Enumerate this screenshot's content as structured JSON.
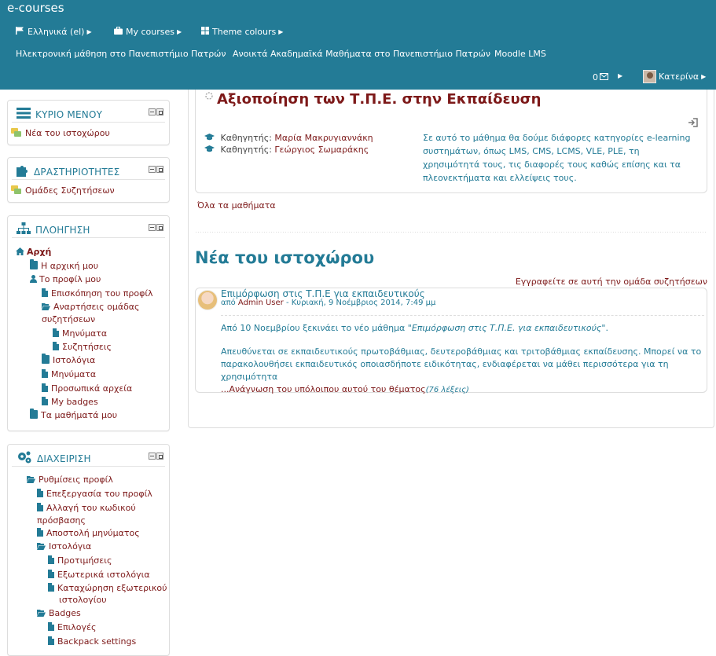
{
  "header": {
    "brand": "e-courses",
    "menu": {
      "language": "Ελληνικά (el)",
      "my_courses": "My courses",
      "theme_colours": "Theme colours"
    },
    "links": [
      "Ηλεκτρονική μάθηση στο Πανεπιστήμιο Πατρών",
      "Ανοικτά Ακαδημαϊκά Μαθήματα στο Πανεπιστήμιο Πατρών",
      "Moodle LMS"
    ],
    "messages_count": "0",
    "user_name": "Κατερίνα",
    "colors": {
      "bar": "#237b96"
    }
  },
  "blocks": {
    "main_menu": {
      "title": "ΚΥΡΙΟ ΜΕΝΟΥ",
      "items": [
        "Νέα του ιστοχώρου"
      ]
    },
    "activities": {
      "title": "ΔΡΑΣΤΗΡΙΟΤΗΤΕΣ",
      "items": [
        "Ομάδες Συζητήσεων"
      ]
    },
    "navigation": {
      "title": "ΠΛΟΗΓΗΣΗ",
      "items": [
        "Αρχή",
        "Η αρχική μου",
        "Το προφίλ μου",
        "Επισκόπηση του προφίλ",
        "Αναρτήσεις ομάδας",
        "συζητήσεων",
        "Μηνύματα",
        "Συζητήσεις",
        "Ιστολόγια",
        "Μηνύματα",
        "Προσωπικά αρχεία",
        "My badges",
        "Τα μαθήματά μου"
      ]
    },
    "administration": {
      "title": "ΔΙΑΧΕΙΡΙΣΗ",
      "items": [
        "Ρυθμίσεις προφίλ",
        "Επεξεργασία του προφίλ",
        "Αλλαγή του κωδικού",
        "πρόσβασης",
        "Αποστολή μηνύματος",
        "Ιστολόγια",
        "Προτιμήσεις",
        "Εξωτερικά ιστολόγια",
        "Καταχώρηση εξωτερικού",
        "ιστολογίου",
        "Badges",
        "Επιλογές",
        "Backpack settings"
      ]
    }
  },
  "course": {
    "title": "Αξιοποίηση των Τ.Π.Ε. στην Εκπαίδευση",
    "teacher_label": "Καθηγητής:",
    "teachers": [
      "Μαρία Μακρυγιαννάκη",
      "Γεώργιος Σωμαράκης"
    ],
    "summary": "Σε αυτό το μάθημα θα δούμε διάφορες κατηγορίες e-learning συστημάτων, όπως LMS, CMS, LCMS, VLE, PLE, τη χρησιμότητά τους, τις διαφορές τους καθώς επίσης και τα πλεονεκτήματα και ελλείψεις τους.",
    "all_courses": "Όλα τα μαθήματα"
  },
  "news": {
    "heading": "Νέα του ιστοχώρου",
    "subscribe": "Εγγραφείτε σε αυτή την ομάδα συζητήσεων",
    "post": {
      "subject": "Επιμόρφωση στις Τ.Π.Ε για εκπαιδευτικούς",
      "by": "από",
      "author": "Admin User",
      "date": "- Κυριακή, 9 Νοέμβριος 2014, 7:49 μμ",
      "p1_start": "Από 10 Νοεμβρίου ξεκινάει το νέο μάθημα  \"",
      "p1_em": "Επιμόρφωση στις Τ.Π.Ε. για εκπαιδευτικούς",
      "p1_end": "\".",
      "p2": "Απευθύνεται σε εκπαιδευτικούς πρωτοβάθμιας, δευτεροβάθμιας και τριτοβάθμιας εκπαίδευσης. Μπορεί να το παρακολουθήσει εκπαιδευτικός οποιασδήποτε ειδικότητας, ενδιαφέρεται να μάθει περισσότερα για τη χρησιμότητα",
      "read_more": "...Ανάγνωση του υπόλοιπου αυτού του θέματος",
      "words": "(76 λέξεις)"
    }
  }
}
